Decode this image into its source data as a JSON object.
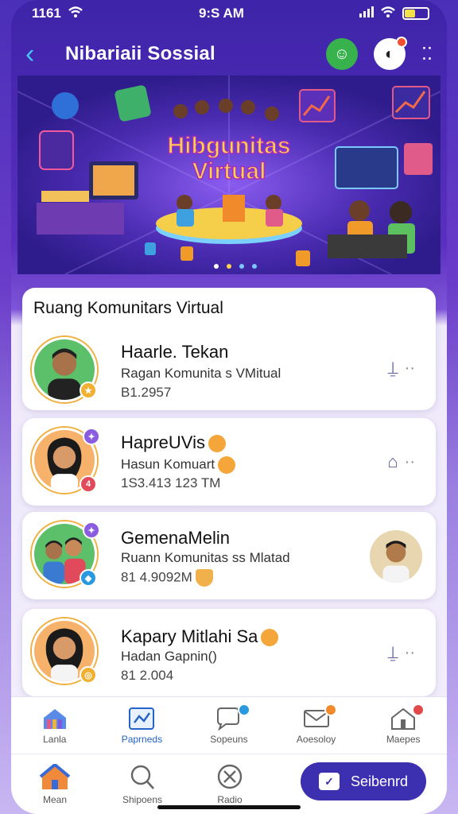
{
  "status_bar": {
    "time_left": "1161",
    "time_center": "9:S AM"
  },
  "header": {
    "title": "Nibariaii Sossial",
    "back_icon": "chevron-left-icon"
  },
  "hero": {
    "banner_title_line1": "Hibgunitas",
    "banner_title_line2": "Virtual"
  },
  "list": {
    "heading": "Ruang Komunitars Virtual",
    "items": [
      {
        "name": "Haarle. Tekan",
        "subtitle": "Ragan Komunita s VMitual",
        "meta": "B1.2957",
        "action_icon": "bookmark-icon"
      },
      {
        "name": "HapreUVis",
        "subtitle": "Hasun Komuart",
        "meta": "1S3.413 123 TM",
        "action_icon": "folder-icon",
        "badge": "4"
      },
      {
        "name": "GemenaMelin",
        "subtitle": "Ruann Komunitas ss Mlatad",
        "meta": "81 4.9092M",
        "action_icon": "avatar-thumbnail"
      },
      {
        "name": "Kapary Mitlahi Sa",
        "subtitle": "Hadan Gapnin()",
        "meta": "81 2.004",
        "action_icon": "bookmark-icon"
      }
    ]
  },
  "tabs": [
    {
      "label": "Lanla",
      "icon": "home-icon",
      "active": false
    },
    {
      "label": "Paprneds",
      "icon": "graph-icon",
      "active": true
    },
    {
      "label": "Sopeuns",
      "icon": "chat-icon",
      "active": false
    },
    {
      "label": "Aoesoloy",
      "icon": "mail-icon",
      "active": false
    },
    {
      "label": "Maepes",
      "icon": "home-alert-icon",
      "active": false
    }
  ],
  "bottom_nav": [
    {
      "label": "Mean",
      "icon": "house-icon"
    },
    {
      "label": "Shipoens",
      "icon": "search-icon"
    },
    {
      "label": "Radio",
      "icon": "close-circle-icon"
    }
  ],
  "send_button": {
    "label": "Seibenrd"
  },
  "colors": {
    "accent": "#3c2fb0",
    "brand_purple": "#5a2fc0",
    "active_tab": "#2563c9"
  }
}
